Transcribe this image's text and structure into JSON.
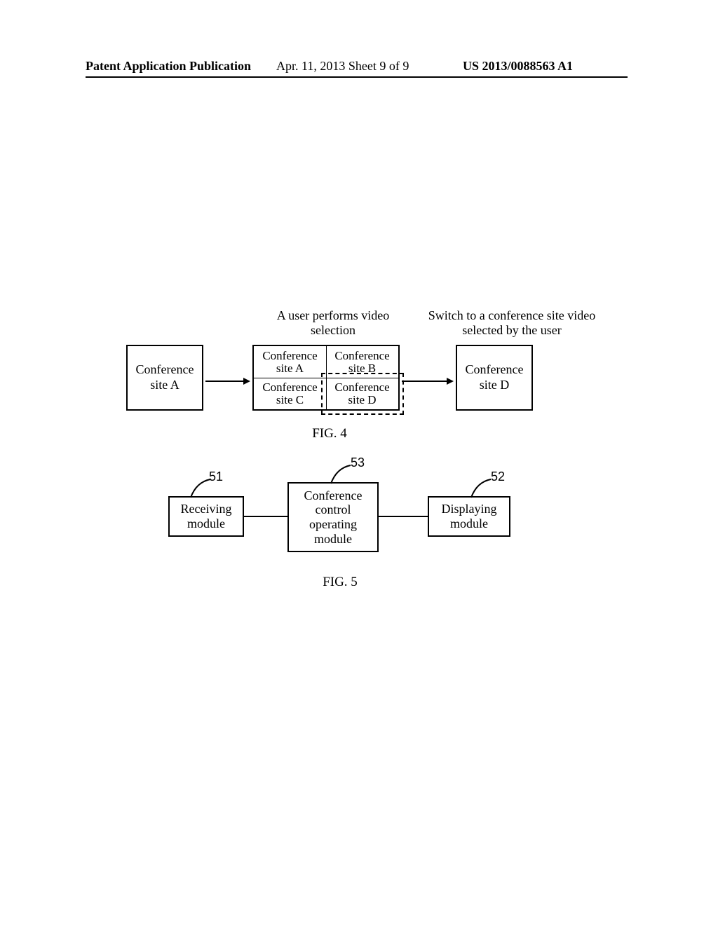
{
  "header": {
    "left": "Patent Application Publication",
    "center": "Apr. 11, 2013  Sheet 9 of 9",
    "right": "US 2013/0088563 A1"
  },
  "fig4": {
    "label_top1": "A user performs video selection",
    "label_top2": "Switch to a conference site video selected by the user",
    "box_a": "Conference site A",
    "cell_a": "Conference site A",
    "cell_b": "Conference site B",
    "cell_c": "Conference site C",
    "cell_d": "Conference site D",
    "box_d": "Conference site D",
    "caption": "FIG. 4"
  },
  "fig5": {
    "ref51": "51",
    "ref52": "52",
    "ref53": "53",
    "mod51": "Receiving module",
    "mod53": "Conference control operating module",
    "mod52": "Displaying module",
    "caption": "FIG. 5"
  }
}
